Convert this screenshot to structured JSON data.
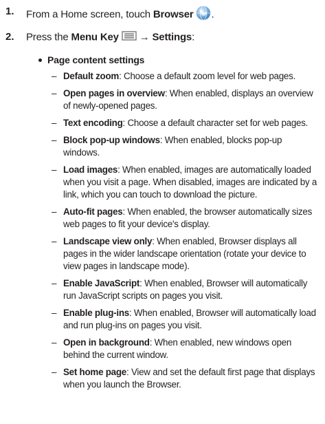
{
  "steps": [
    {
      "number": "1.",
      "prefix": "From a Home screen, touch ",
      "bold": "Browser",
      "suffix": "."
    },
    {
      "number": "2.",
      "prefix": "Press the ",
      "bold1": "Menu Key",
      "arrow": "→",
      "bold2": "Settings",
      "suffix": ":"
    }
  ],
  "section_title": "Page content settings",
  "dash": "–",
  "items": [
    {
      "term": "Default zoom",
      "desc": ": Choose a default zoom level for web pages."
    },
    {
      "term": "Open pages in overview",
      "desc": ": When enabled, displays an overview of newly-opened pages."
    },
    {
      "term": "Text encoding",
      "desc": ": Choose a default character set for web pages."
    },
    {
      "term": "Block pop-up windows",
      "desc": ": When enabled, blocks pop-up windows."
    },
    {
      "term": "Load images",
      "desc": ": When enabled, images are automatically loaded when you visit a page. When disabled, images are indicated by a link, which you can touch to download the picture."
    },
    {
      "term": "Auto-fit pages",
      "desc": ": When enabled, the browser automatically sizes web pages to fit your device's display."
    },
    {
      "term": "Landscape view only",
      "desc": ": When enabled, Browser displays all pages in the wider landscape orientation (rotate your device to view pages in landscape mode)."
    },
    {
      "term": "Enable JavaScript",
      "desc": ": When enabled, Browser will automatically run JavaScript scripts on pages you visit."
    },
    {
      "term": "Enable plug-ins",
      "desc": ": When enabled, Browser will automatically load and run plug-ins on pages you visit."
    },
    {
      "term": "Open in background",
      "desc": ": When enabled, new windows open behind the current window."
    },
    {
      "term": "Set home page",
      "desc": ": View and set the default first page that displays when you launch the Browser."
    }
  ]
}
